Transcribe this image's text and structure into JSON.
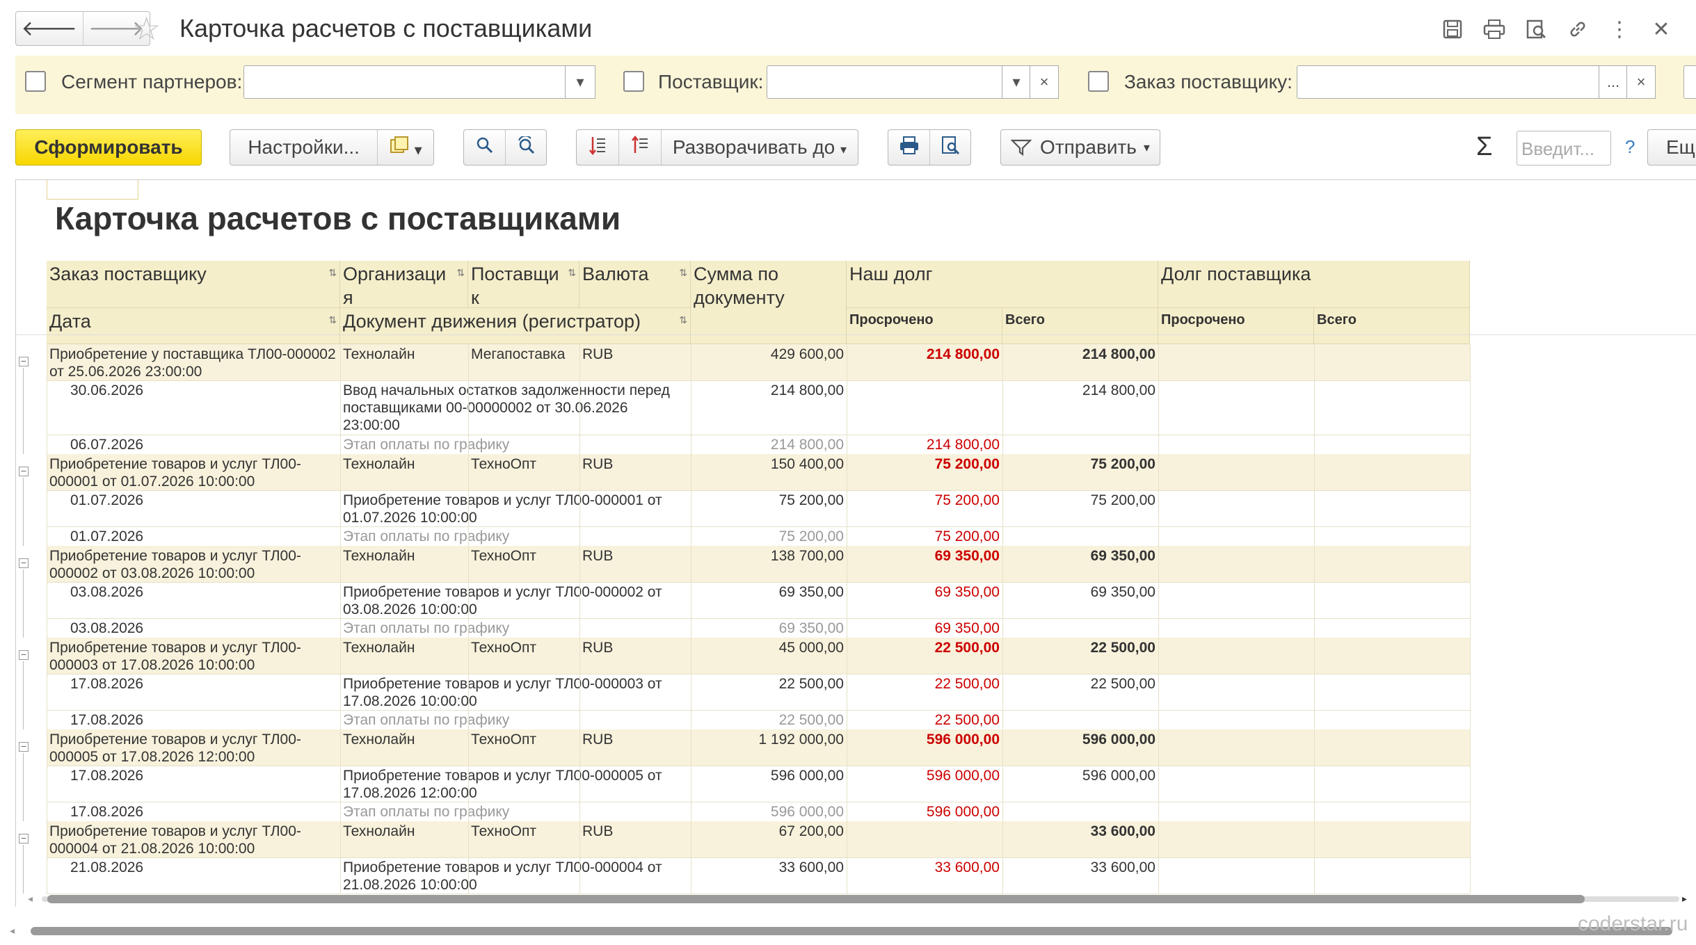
{
  "window": {
    "title": "Карточка расчетов с поставщиками"
  },
  "filters": {
    "segment_label": "Сегмент партнеров:",
    "segment_value": "",
    "supplier_label": "Поставщик:",
    "supplier_value": "",
    "order_label": "Заказ поставщику:",
    "order_value": "",
    "ellipsis": "...",
    "clear": "×",
    "dropdown": "▾"
  },
  "toolbar": {
    "generate": "Сформировать",
    "settings": "Настройки...",
    "expand_to": "Разворачивать до",
    "send": "Отправить",
    "sum_symbol": "Σ",
    "input_placeholder": "Введит...",
    "help": "?",
    "more": "Ещ"
  },
  "report": {
    "title": "Карточка расчетов с поставщиками",
    "headers": {
      "order": "Заказ поставщику",
      "org": "Организация",
      "org_wrap": "я",
      "org_main": "Организаци",
      "supplier_main": "Поставщи",
      "supplier_wrap": "к",
      "currency": "Валюта",
      "sum": "Сумма по документу",
      "our_debt": "Наш долг",
      "supplier_debt": "Долг поставщика",
      "date": "Дата",
      "doc": "Документ движения (регистратор)",
      "overdue": "Просрочено",
      "total": "Всего",
      "overdue2": "Просрочено",
      "total2": "Всего"
    },
    "groups": [
      {
        "order": "Приобретение у поставщика ТЛ00-000002 от 25.06.2026 23:00:00",
        "org": "Технолайн",
        "supplier": "Мегапоставка",
        "currency": "RUB",
        "sum": "429 600,00",
        "overdue": "214 800,00",
        "total": "214 800,00",
        "rows": [
          {
            "date": "30.06.2026",
            "doc": "Ввод начальных остатков задолженности перед поставщиками 00-00000002 от 30.06.2026 23:00:00",
            "sum": "214 800,00",
            "overdue": "",
            "total": "214 800,00",
            "stage": false
          },
          {
            "date": "06.07.2026",
            "doc": "Этап оплаты по графику",
            "sum": "214 800,00",
            "overdue": "214 800,00",
            "total": "",
            "stage": true
          }
        ]
      },
      {
        "order": "Приобретение товаров и услуг ТЛ00-000001 от 01.07.2026 10:00:00",
        "org": "Технолайн",
        "supplier": "ТехноОпт",
        "currency": "RUB",
        "sum": "150 400,00",
        "overdue": "75 200,00",
        "total": "75 200,00",
        "rows": [
          {
            "date": "01.07.2026",
            "doc": "Приобретение товаров и услуг ТЛ00-000001 от 01.07.2026 10:00:00",
            "sum": "75 200,00",
            "overdue": "75 200,00",
            "total": "75 200,00",
            "stage": false
          },
          {
            "date": "01.07.2026",
            "doc": "Этап оплаты по графику",
            "sum": "75 200,00",
            "overdue": "75 200,00",
            "total": "",
            "stage": true
          }
        ]
      },
      {
        "order": "Приобретение товаров и услуг ТЛ00-000002 от 03.08.2026 10:00:00",
        "org": "Технолайн",
        "supplier": "ТехноОпт",
        "currency": "RUB",
        "sum": "138 700,00",
        "overdue": "69 350,00",
        "total": "69 350,00",
        "rows": [
          {
            "date": "03.08.2026",
            "doc": "Приобретение товаров и услуг ТЛ00-000002 от 03.08.2026 10:00:00",
            "sum": "69 350,00",
            "overdue": "69 350,00",
            "total": "69 350,00",
            "stage": false
          },
          {
            "date": "03.08.2026",
            "doc": "Этап оплаты по графику",
            "sum": "69 350,00",
            "overdue": "69 350,00",
            "total": "",
            "stage": true
          }
        ]
      },
      {
        "order": "Приобретение товаров и услуг ТЛ00-000003 от 17.08.2026 10:00:00",
        "org": "Технолайн",
        "supplier": "ТехноОпт",
        "currency": "RUB",
        "sum": "45 000,00",
        "overdue": "22 500,00",
        "total": "22 500,00",
        "rows": [
          {
            "date": "17.08.2026",
            "doc": "Приобретение товаров и услуг ТЛ00-000003 от 17.08.2026 10:00:00",
            "sum": "22 500,00",
            "overdue": "22 500,00",
            "total": "22 500,00",
            "stage": false
          },
          {
            "date": "17.08.2026",
            "doc": "Этап оплаты по графику",
            "sum": "22 500,00",
            "overdue": "22 500,00",
            "total": "",
            "stage": true
          }
        ]
      },
      {
        "order": "Приобретение товаров и услуг ТЛ00-000005 от 17.08.2026 12:00:00",
        "org": "Технолайн",
        "supplier": "ТехноОпт",
        "currency": "RUB",
        "sum": "1 192 000,00",
        "overdue": "596 000,00",
        "total": "596 000,00",
        "rows": [
          {
            "date": "17.08.2026",
            "doc": "Приобретение товаров и услуг ТЛ00-000005 от 17.08.2026 12:00:00",
            "sum": "596 000,00",
            "overdue": "596 000,00",
            "total": "596 000,00",
            "stage": false
          },
          {
            "date": "17.08.2026",
            "doc": "Этап оплаты по графику",
            "sum": "596 000,00",
            "overdue": "596 000,00",
            "total": "",
            "stage": true
          }
        ]
      },
      {
        "order": "Приобретение товаров и услуг ТЛ00-000004 от 21.08.2026 10:00:00",
        "org": "Технолайн",
        "supplier": "ТехноОпт",
        "currency": "RUB",
        "sum": "67 200,00",
        "overdue": "",
        "total": "33 600,00",
        "rows": [
          {
            "date": "21.08.2026",
            "doc": "Приобретение товаров и услуг ТЛ00-000004 от 21.08.2026 10:00:00",
            "sum": "33 600,00",
            "overdue": "33 600,00",
            "total": "33 600,00",
            "stage": false
          }
        ]
      }
    ]
  },
  "watermark": "coderstar.ru",
  "colors": {
    "accent_yellow": "#f7d600",
    "header_bg": "#f5eecb",
    "group_bg": "#f8f2dc",
    "overdue_red": "#c00000"
  }
}
